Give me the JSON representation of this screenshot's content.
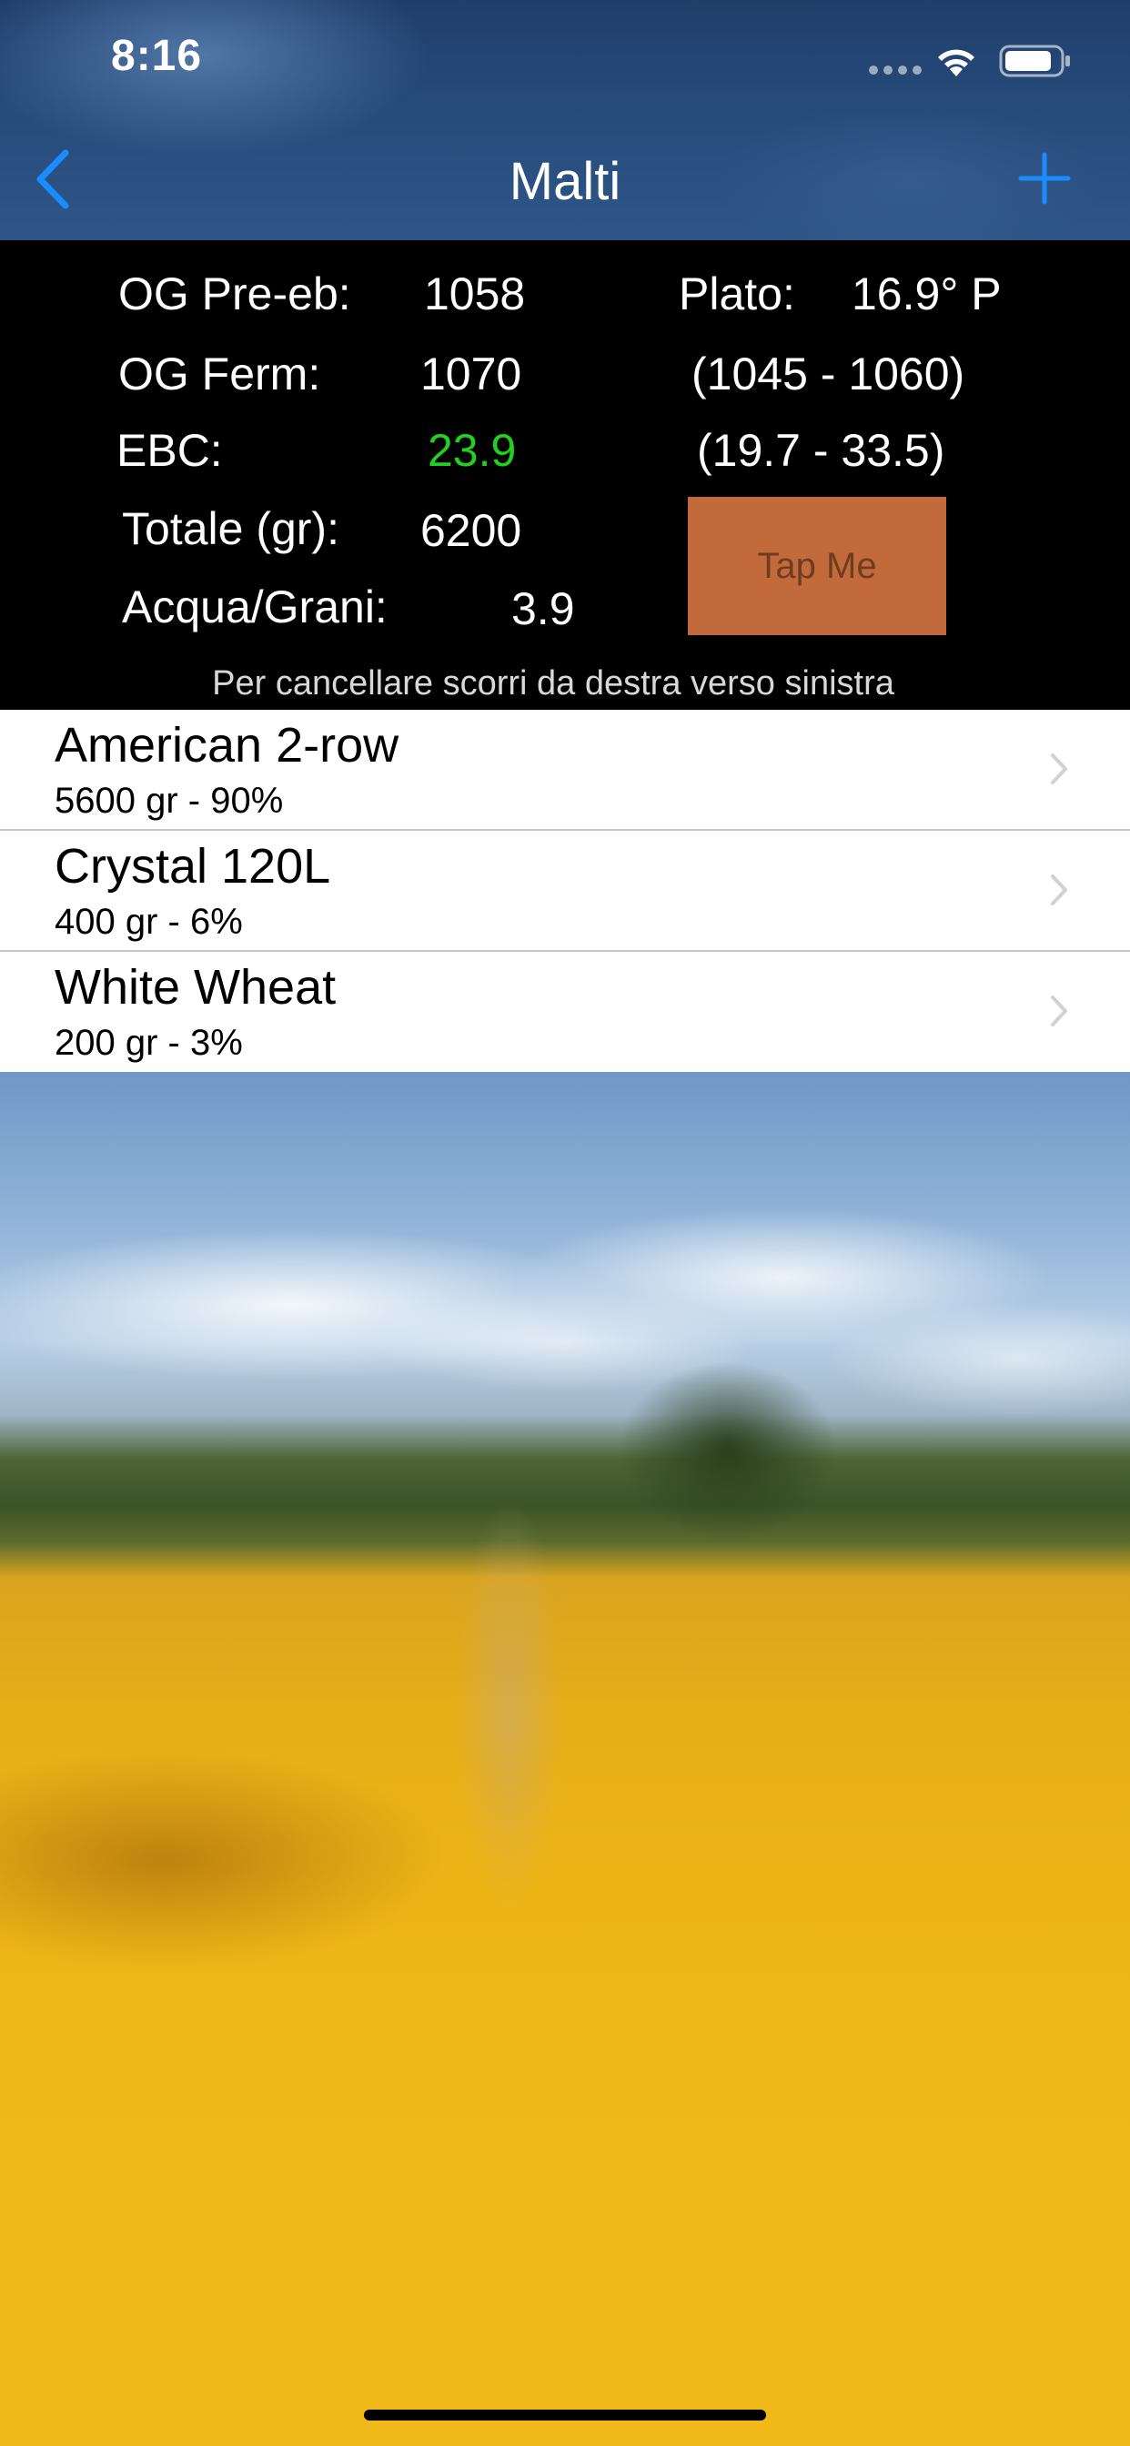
{
  "status": {
    "time": "8:16"
  },
  "nav": {
    "title": "Malti"
  },
  "stats": {
    "og_pre_label": "OG Pre-eb:",
    "og_pre_value": "1058",
    "plato_label": "Plato:",
    "plato_value": "16.9° P",
    "og_ferm_label": "OG Ferm:",
    "og_ferm_value": "1070",
    "og_range": "(1045 - 1060)",
    "ebc_label": "EBC:",
    "ebc_value": "23.9",
    "ebc_range": "(19.7 - 33.5)",
    "totale_label": "Totale (gr):",
    "totale_value": "6200",
    "acqua_label": "Acqua/Grani:",
    "acqua_value": "3.9",
    "tap_button": "Tap Me",
    "hint": "Per cancellare scorri da destra verso sinistra",
    "ebc_color": "#22d11f",
    "button_color": "#c26a3b"
  },
  "malts": [
    {
      "name": "American 2-row",
      "detail": "5600 gr - 90%"
    },
    {
      "name": "Crystal 120L",
      "detail": "400 gr - 6%"
    },
    {
      "name": "White Wheat",
      "detail": "200 gr - 3%"
    }
  ],
  "colors": {
    "accent": "#1a8cff"
  }
}
